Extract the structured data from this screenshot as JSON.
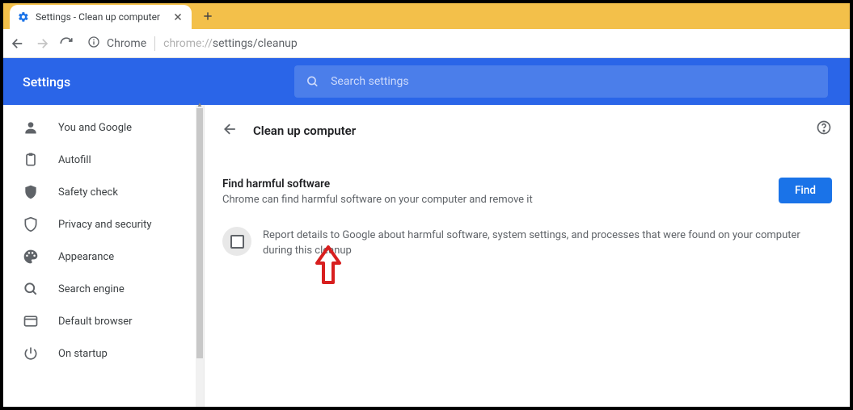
{
  "tab": {
    "title": "Settings - Clean up computer"
  },
  "address": {
    "scheme_label": "Chrome",
    "url_prefix": "chrome://",
    "url_path": "settings/cleanup"
  },
  "header": {
    "title": "Settings"
  },
  "search": {
    "placeholder": "Search settings"
  },
  "sidebar": {
    "items": [
      {
        "label": "You and Google"
      },
      {
        "label": "Autofill"
      },
      {
        "label": "Safety check"
      },
      {
        "label": "Privacy and security"
      },
      {
        "label": "Appearance"
      },
      {
        "label": "Search engine"
      },
      {
        "label": "Default browser"
      },
      {
        "label": "On startup"
      }
    ]
  },
  "content": {
    "page_title": "Clean up computer",
    "find_section": {
      "heading": "Find harmful software",
      "description": "Chrome can find harmful software on your computer and remove it",
      "button": "Find"
    },
    "report_text": "Report details to Google about harmful software, system settings, and processes that were found on your computer during this cleanup"
  }
}
